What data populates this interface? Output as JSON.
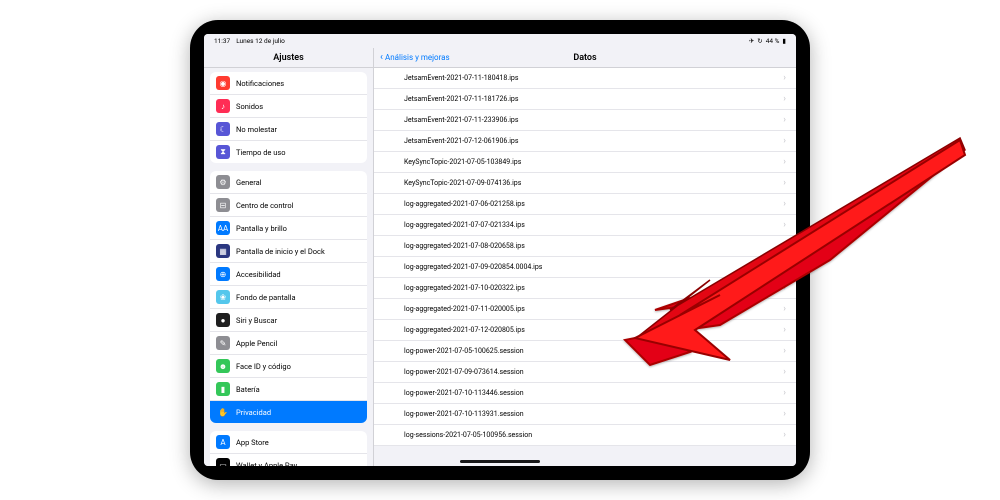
{
  "status": {
    "time": "11:37",
    "date": "Lunes 12 de julio",
    "battery": "44 %"
  },
  "header": {
    "left_title": "Ajustes",
    "back_label": "Análisis y mejoras",
    "right_title": "Datos"
  },
  "sidebar": {
    "group1": [
      {
        "label": "Notificaciones",
        "color": "#ff3b30",
        "glyph": "◉"
      },
      {
        "label": "Sonidos",
        "color": "#ff2d55",
        "glyph": "♪"
      },
      {
        "label": "No molestar",
        "color": "#5856d6",
        "glyph": "☾"
      },
      {
        "label": "Tiempo de uso",
        "color": "#5856d6",
        "glyph": "⧗"
      }
    ],
    "group2": [
      {
        "label": "General",
        "color": "#8e8e93",
        "glyph": "⚙"
      },
      {
        "label": "Centro de control",
        "color": "#8e8e93",
        "glyph": "⊟"
      },
      {
        "label": "Pantalla y brillo",
        "color": "#007aff",
        "glyph": "AA"
      },
      {
        "label": "Pantalla de inicio y el Dock",
        "color": "#2b3780",
        "glyph": "▦"
      },
      {
        "label": "Accesibilidad",
        "color": "#007aff",
        "glyph": "⊕"
      },
      {
        "label": "Fondo de pantalla",
        "color": "#54c7ec",
        "glyph": "❀"
      },
      {
        "label": "Siri y Buscar",
        "color": "#1f1f1f",
        "glyph": "●"
      },
      {
        "label": "Apple Pencil",
        "color": "#8e8e93",
        "glyph": "✎"
      },
      {
        "label": "Face ID y código",
        "color": "#34c759",
        "glyph": "☻"
      },
      {
        "label": "Batería",
        "color": "#34c759",
        "glyph": "▮"
      },
      {
        "label": "Privacidad",
        "color": "#007aff",
        "glyph": "✋",
        "selected": true
      }
    ],
    "group3": [
      {
        "label": "App Store",
        "color": "#007aff",
        "glyph": "A"
      },
      {
        "label": "Wallet y Apple Pay",
        "color": "#000",
        "glyph": "▭"
      }
    ]
  },
  "files": [
    "JetsamEvent-2021-07-11-180418.ips",
    "JetsamEvent-2021-07-11-181726.ips",
    "JetsamEvent-2021-07-11-233906.ips",
    "JetsamEvent-2021-07-12-061906.ips",
    "KeySyncTopic-2021-07-05-103849.ips",
    "KeySyncTopic-2021-07-09-074136.ips",
    "log-aggregated-2021-07-06-021258.ips",
    "log-aggregated-2021-07-07-021334.ips",
    "log-aggregated-2021-07-08-020658.ips",
    "log-aggregated-2021-07-09-020854.0004.ips",
    "log-aggregated-2021-07-10-020322.ips",
    "log-aggregated-2021-07-11-020005.ips",
    "log-aggregated-2021-07-12-020805.ips",
    "log-power-2021-07-05-100625.session",
    "log-power-2021-07-09-073614.session",
    "log-power-2021-07-10-113446.session",
    "log-power-2021-07-10-113931.session",
    "log-sessions-2021-07-05-100956.session"
  ]
}
